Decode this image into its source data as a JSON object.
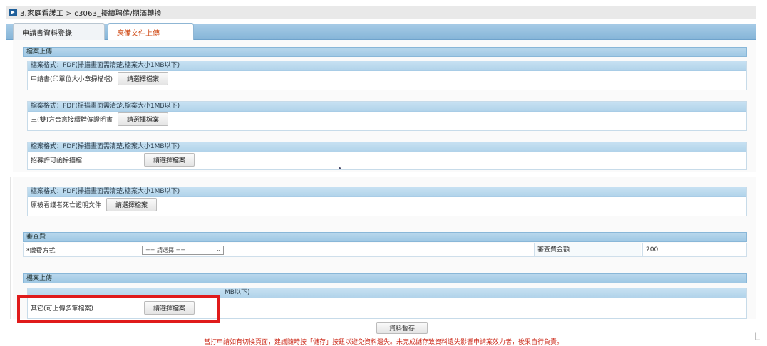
{
  "title": "3.家庭看護工 > c3063_接續聘僱/期滿轉換",
  "tabs": [
    "申請書資料登錄",
    "應備文件上傳"
  ],
  "upload_section_title": "檔案上傳",
  "file_format_note": "檔案格式：PDF(掃描畫面需清楚,檔案大小1MB以下)",
  "file_format_note_partial": "MB以下)",
  "choose_file_label": "請選擇檔案",
  "uploads": [
    {
      "label": "申請書(印單位大小章掃描檔)"
    },
    {
      "label": "三(雙)方合意接續聘僱證明書"
    },
    {
      "label": "招募許可函掃描檔"
    },
    {
      "label": "原被看護者死亡證明文件"
    }
  ],
  "fee_section": {
    "title": "審查費",
    "pay_label": "*繳費方式",
    "select_value": "== 請選擇 ==",
    "amount_label": "審查費金額",
    "amount": "200"
  },
  "other_upload": {
    "section_title": "檔案上傳",
    "label": "其它(可上傳多筆檔案)"
  },
  "save_label": "資料暫存",
  "notice": "當打申請如有切換頁面，建議隨時按「儲存」按鈕以避免資料遺失。未完成儲存致資料遺失影響申請案效力者，後果自行負責。",
  "corner_glyph": "L"
}
